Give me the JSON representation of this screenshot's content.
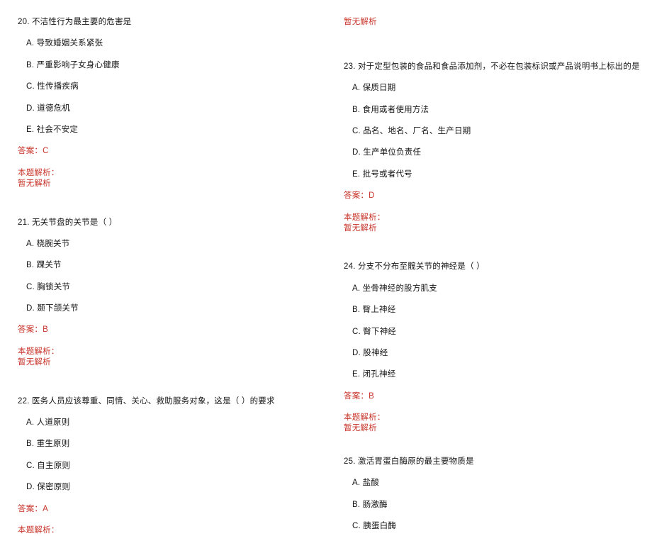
{
  "document": {
    "language": "zh-CN",
    "colors": {
      "text": "#151515",
      "answer_red": "#c8352b",
      "background": "#ffffff"
    },
    "labels": {
      "answer_prefix": "答案：",
      "explanation_label": "本题解析：",
      "explanation_empty": "暂无解析"
    }
  },
  "left_column": {
    "questions": [
      {
        "stem": "20. 不洁性行为最主要的危害是",
        "options": [
          "A. 导致婚姻关系紧张",
          "B. 严重影响子女身心健康",
          "C. 性传播疾病",
          "D. 道德危机",
          "E. 社会不安定"
        ],
        "answer": "答案：C",
        "explanation_label": "本题解析：",
        "explanation_body": "暂无解析"
      },
      {
        "stem": "21. 无关节盘的关节是（ ）",
        "options": [
          "A. 桡腕关节",
          "B. 踝关节",
          "C. 胸锁关节",
          "D. 颞下颌关节"
        ],
        "answer": "答案：B",
        "explanation_label": "本题解析：",
        "explanation_body": "暂无解析"
      },
      {
        "stem": "22. 医务人员应该尊重、同情、关心、救助服务对象，这是（  ）的要求",
        "options": [
          "A. 人道原则",
          "B. 重生原则",
          "C. 自主原则",
          "D. 保密原则"
        ],
        "answer": "答案：A",
        "explanation_label": "本题解析：",
        "explanation_body": ""
      }
    ]
  },
  "right_column": {
    "orphan_explanation": "暂无解析",
    "questions": [
      {
        "stem": "23. 对于定型包装的食品和食品添加剂，不必在包装标识或产品说明书上标出的是",
        "options": [
          "A. 保质日期",
          "B. 食用或者使用方法",
          "C. 品名、地名、厂名、生产日期",
          "D. 生产单位负责任",
          "E. 批号或者代号"
        ],
        "answer": "答案：D",
        "explanation_label": "本题解析：",
        "explanation_body": "暂无解析"
      },
      {
        "stem": "24. 分支不分布至髋关节的神经是（ ）",
        "options": [
          "A. 坐骨神经的股方肌支",
          "B. 臀上神经",
          "C. 臀下神经",
          "D. 股神经",
          "E. 闭孔神经"
        ],
        "answer": "答案：B",
        "explanation_label": "本题解析：",
        "explanation_body": "暂无解析"
      },
      {
        "stem": "25. 激活胃蛋白酶原的最主要物质是",
        "options": [
          "A. 盐酸",
          "B. 肠激酶",
          "C. 胰蛋白酶"
        ],
        "answer": "",
        "explanation_label": "",
        "explanation_body": ""
      }
    ]
  }
}
